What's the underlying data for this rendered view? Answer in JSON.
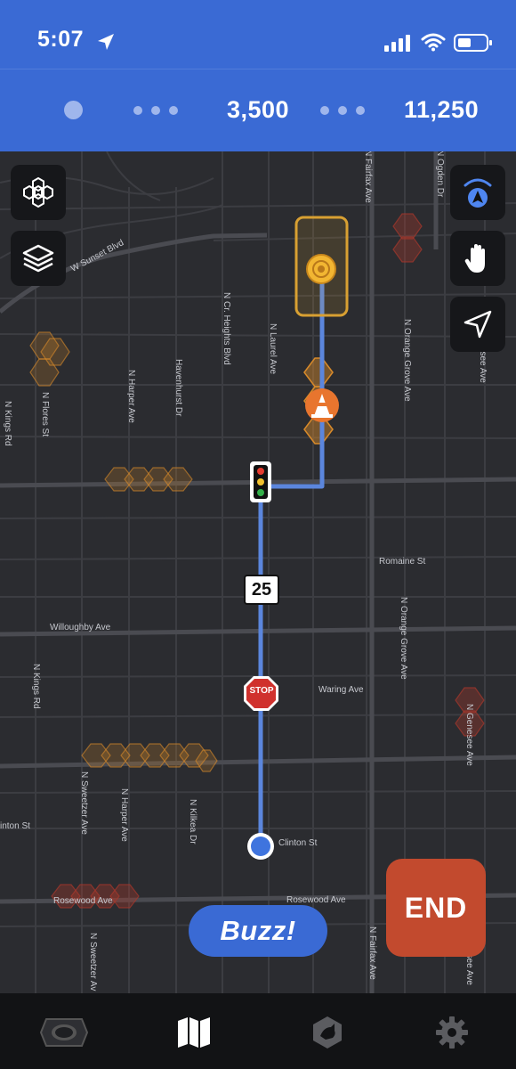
{
  "status_bar": {
    "time": "5:07",
    "icons": [
      "location-arrow-icon",
      "cellular-signal-icon",
      "wifi-icon",
      "battery-icon"
    ]
  },
  "progress": {
    "first_milestone": "3,500",
    "second_milestone": "11,250"
  },
  "map": {
    "streets": {
      "w_sunset": "W Sunset Blvd",
      "n_flores": "N Flores St",
      "n_kings_top": "N Kings Rd",
      "n_harper_top": "N Harper Ave",
      "havenhurst": "Havenhurst Dr",
      "n_crescent": "N Cr. Heights Blvd",
      "n_laurel": "N Laurel Ave",
      "n_fairfax_top": "N Fairfax Ave",
      "n_orange_top": "N Orange Grove Ave",
      "n_genesee_top": "N Genesee Ave",
      "n_ogden": "N Ogden Dr",
      "romaine": "Romaine St",
      "willoughby": "Willoughby Ave",
      "n_kings_mid": "N Kings Rd",
      "n_orange_mid": "N Orange Grove Ave",
      "waring": "Waring Ave",
      "n_genesee_mid": "N Genesee Ave",
      "clinton_left": "inton St",
      "clinton_right": "Clinton St",
      "n_sweetzer_mid": "N Sweetzer Ave",
      "n_harper_mid": "N Harper Ave",
      "n_kilkea": "N Kilkea Dr",
      "rosewood_left": "Rosewood Ave",
      "rosewood_right": "Rosewood Ave",
      "n_sweetzer_bottom": "N Sweetzer Av",
      "n_fairfax_bottom": "N Fairfax Ave",
      "n_genesee_bottom": "esee Ave"
    },
    "speed_limit": "25",
    "stop_sign": "STOP",
    "left_buttons": [
      "hexagon-grid-icon",
      "layers-icon"
    ],
    "right_buttons": [
      "auto-navigation-icon",
      "hand-stop-icon",
      "navigate-arrow-icon"
    ]
  },
  "actions": {
    "buzz_label": "Buzz!",
    "end_label": "END"
  },
  "tabbar": {
    "tabs": [
      "camera-tab-icon",
      "map-tab-icon",
      "dashcam-tab-icon",
      "settings-tab-icon"
    ],
    "active_tab": "map-tab-icon"
  },
  "colors": {
    "header_blue": "#3a6ad4",
    "route_blue": "#5b86dd",
    "map_background": "#2b2c30",
    "end_button": "#c24a2e",
    "hex_orange": "#d88a2a",
    "hex_red": "#a8382c"
  }
}
